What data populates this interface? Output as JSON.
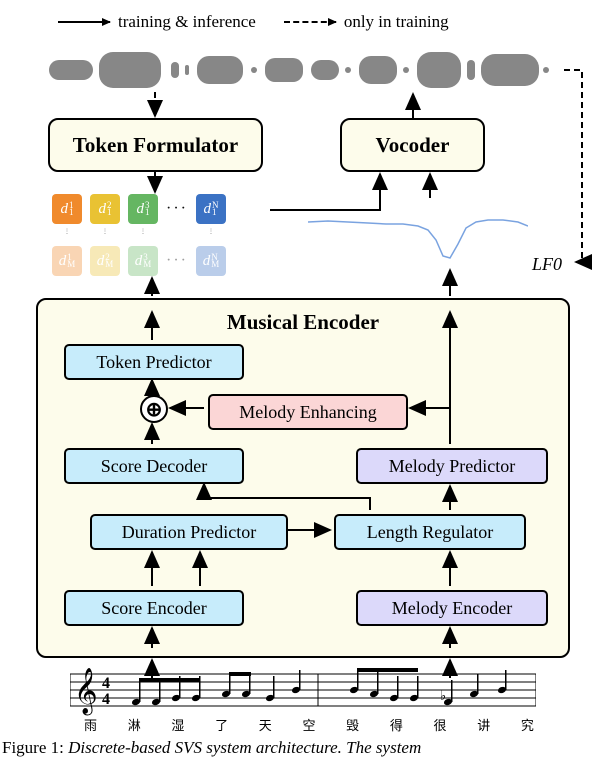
{
  "legend": {
    "left_label": "training & inference",
    "right_label": "only in training"
  },
  "blocks": {
    "token_formulator": "Token Formulator",
    "vocoder": "Vocoder"
  },
  "lf0_label": "LF0",
  "musical_encoder": {
    "title": "Musical Encoder",
    "token_predictor": "Token Predictor",
    "melody_enhancing": "Melody Enhancing",
    "score_decoder": "Score Decoder",
    "melody_predictor": "Melody Predictor",
    "duration_predictor": "Duration Predictor",
    "length_regulator": "Length Regulator",
    "score_encoder": "Score Encoder",
    "melody_encoder": "Melody Encoder"
  },
  "tokens": {
    "top_row": [
      {
        "base": "d",
        "sub": "1",
        "sup": "1",
        "color": "#f08a2c"
      },
      {
        "base": "d",
        "sub": "1",
        "sup": "2",
        "color": "#e9c233"
      },
      {
        "base": "d",
        "sub": "1",
        "sup": "3",
        "color": "#65b662"
      },
      {
        "base": "d",
        "sub": "1",
        "sup": "N",
        "color": "#3b72c4"
      }
    ],
    "bottom_row": [
      {
        "base": "d",
        "sub": "M",
        "sup": "1",
        "color": "#f08a2c"
      },
      {
        "base": "d",
        "sub": "M",
        "sup": "2",
        "color": "#e9c233"
      },
      {
        "base": "d",
        "sub": "M",
        "sup": "3",
        "color": "#65b662"
      },
      {
        "base": "d",
        "sub": "M",
        "sup": "N",
        "color": "#3b72c4"
      }
    ],
    "h_ellipsis": "···",
    "v_ellipsis": "⋮"
  },
  "lyrics": [
    "雨",
    "淋",
    "湿",
    "了",
    "天",
    "空",
    "毁",
    "得",
    "很",
    "讲",
    "究"
  ],
  "caption": {
    "fignum": "Figure 1: ",
    "title": "Discrete-based SVS system architecture. The system"
  },
  "chart_data": {
    "type": "diagram",
    "title": "Discrete-based SVS system architecture",
    "nodes": [
      {
        "id": "waveform",
        "label": "audio waveform"
      },
      {
        "id": "token_formulator",
        "label": "Token Formulator"
      },
      {
        "id": "vocoder",
        "label": "Vocoder"
      },
      {
        "id": "discrete_tokens",
        "label": "discrete tokens d_1^1..d_M^N"
      },
      {
        "id": "lf0",
        "label": "LF0"
      },
      {
        "id": "musical_encoder",
        "label": "Musical Encoder"
      },
      {
        "id": "token_predictor",
        "label": "Token Predictor"
      },
      {
        "id": "melody_enhancing",
        "label": "Melody Enhancing"
      },
      {
        "id": "score_decoder",
        "label": "Score Decoder"
      },
      {
        "id": "melody_predictor",
        "label": "Melody Predictor"
      },
      {
        "id": "duration_predictor",
        "label": "Duration Predictor"
      },
      {
        "id": "length_regulator",
        "label": "Length Regulator"
      },
      {
        "id": "score_encoder",
        "label": "Score Encoder"
      },
      {
        "id": "melody_encoder",
        "label": "Melody Encoder"
      },
      {
        "id": "music_score",
        "label": "music score with lyrics"
      }
    ],
    "edges": [
      {
        "from": "waveform",
        "to": "token_formulator",
        "style": "dashed"
      },
      {
        "from": "waveform",
        "to": "lf0",
        "style": "dashed"
      },
      {
        "from": "token_formulator",
        "to": "discrete_tokens",
        "style": "solid"
      },
      {
        "from": "discrete_tokens",
        "to": "vocoder",
        "style": "solid"
      },
      {
        "from": "lf0",
        "to": "vocoder",
        "style": "solid"
      },
      {
        "from": "vocoder",
        "to": "waveform",
        "style": "solid"
      },
      {
        "from": "music_score",
        "to": "score_encoder",
        "style": "solid"
      },
      {
        "from": "music_score",
        "to": "melody_encoder",
        "style": "solid"
      },
      {
        "from": "score_encoder",
        "to": "duration_predictor",
        "style": "solid"
      },
      {
        "from": "score_encoder",
        "to": "length_regulator",
        "style": "solid"
      },
      {
        "from": "duration_predictor",
        "to": "length_regulator",
        "style": "solid"
      },
      {
        "from": "melody_encoder",
        "to": "length_regulator",
        "style": "solid"
      },
      {
        "from": "length_regulator",
        "to": "score_decoder",
        "style": "solid"
      },
      {
        "from": "length_regulator",
        "to": "melody_predictor",
        "style": "solid"
      },
      {
        "from": "melody_predictor",
        "to": "melody_enhancing",
        "style": "solid"
      },
      {
        "from": "score_decoder",
        "to": "combine",
        "style": "solid"
      },
      {
        "from": "melody_enhancing",
        "to": "combine",
        "style": "solid"
      },
      {
        "from": "combine",
        "to": "token_predictor",
        "style": "solid"
      },
      {
        "from": "token_predictor",
        "to": "discrete_tokens",
        "style": "solid"
      },
      {
        "from": "melody_predictor",
        "to": "lf0",
        "style": "solid"
      }
    ]
  }
}
